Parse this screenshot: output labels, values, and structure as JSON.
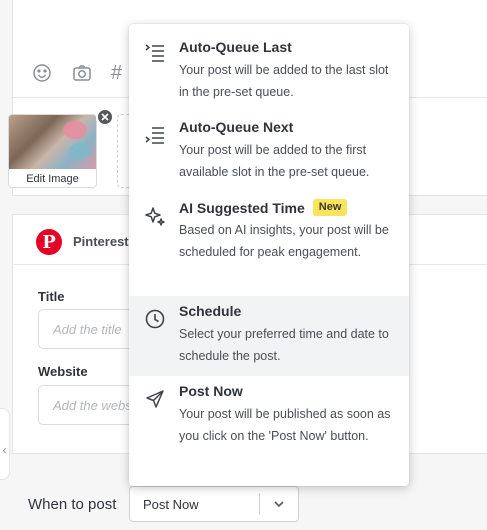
{
  "composer": {
    "toolbar_icons": [
      "emoji-icon",
      "camera-icon",
      "hashtag-icon"
    ],
    "hashtag_glyph": "#",
    "media": {
      "thumbnail_label": "Edit Image"
    }
  },
  "pinterest": {
    "network_name": "Pinterest",
    "logo_glyph": "P",
    "brand_color": "#e60023",
    "fields": [
      {
        "label": "Title",
        "placeholder": "Add the title"
      },
      {
        "label": "Website",
        "placeholder": "Add the website"
      }
    ]
  },
  "side_handle": {
    "glyph": "‹"
  },
  "when_to_post": {
    "label": "When to post",
    "selected": "Post Now"
  },
  "menu": {
    "items": [
      {
        "icon": "queue-last-icon",
        "title": "Auto-Queue Last",
        "description": "Your post will be added to the last slot in the pre-set queue.",
        "badge": ""
      },
      {
        "icon": "queue-next-icon",
        "title": "Auto-Queue Next",
        "description": "Your post will be added to the first available slot in the pre-set queue.",
        "badge": ""
      },
      {
        "icon": "sparkle-icon",
        "title": "AI Suggested Time",
        "description": "Based on AI insights, your post will be scheduled for peak engagement.",
        "badge": "New"
      },
      {
        "icon": "clock-icon",
        "title": "Schedule",
        "description": "Select your preferred time and date to schedule the post.",
        "badge": ""
      },
      {
        "icon": "send-icon",
        "title": "Post Now",
        "description": "Your post will be published as soon as you click on the 'Post Now' button.",
        "badge": ""
      }
    ],
    "highlighted_index": 3,
    "badge_color": "#fbe35b"
  }
}
